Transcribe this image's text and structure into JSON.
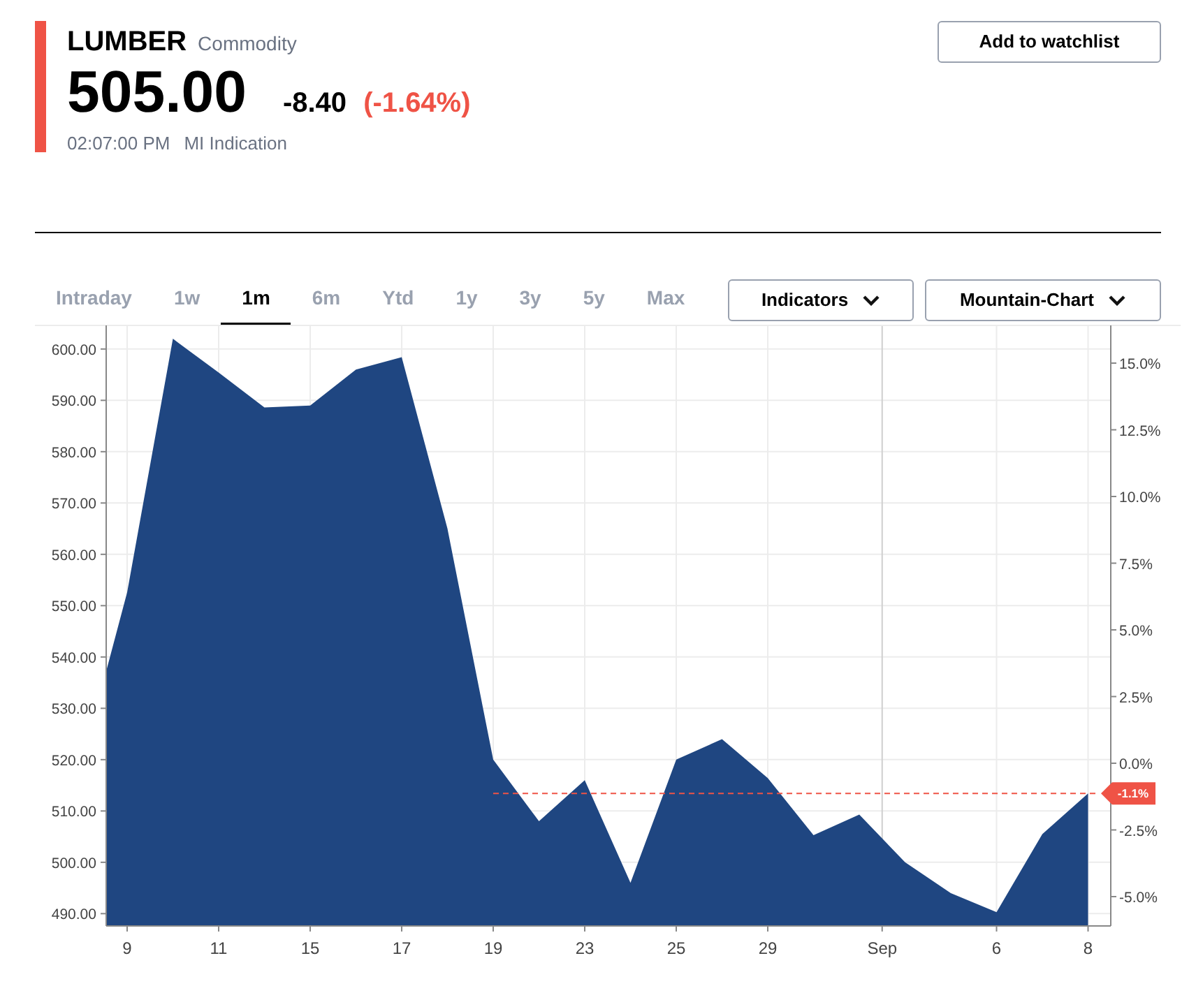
{
  "quote": {
    "symbol": "LUMBER",
    "type": "Commodity",
    "price": "505.00",
    "change": "-8.40",
    "change_percent": "(-1.64%)",
    "time": "02:07:00 PM",
    "source": "MI Indication"
  },
  "watchlist_button": "Add to watchlist",
  "range_tabs": [
    {
      "label": "Intraday",
      "selected": false
    },
    {
      "label": "1w",
      "selected": false
    },
    {
      "label": "1m",
      "selected": true
    },
    {
      "label": "6m",
      "selected": false
    },
    {
      "label": "Ytd",
      "selected": false
    },
    {
      "label": "1y",
      "selected": false
    },
    {
      "label": "3y",
      "selected": false
    },
    {
      "label": "5y",
      "selected": false
    },
    {
      "label": "Max",
      "selected": false
    }
  ],
  "dropdowns": [
    {
      "label": "Indicators"
    },
    {
      "label": "Mountain-Chart"
    }
  ],
  "chart": {
    "right_axis_labels": [
      "15.0%",
      "12.5%",
      "10.0%",
      "7.5%",
      "5.0%",
      "2.5%",
      "0.0%",
      "-2.5%",
      "-5.0%"
    ],
    "chart_data": {
      "type": "area",
      "categories": [
        null,
        "9",
        null,
        "11",
        null,
        "15",
        null,
        "17",
        null,
        "19",
        null,
        "23",
        null,
        "25",
        null,
        "29",
        null,
        null,
        null,
        null,
        "6",
        null,
        "8"
      ],
      "series": [
        {
          "color": "#1f4681",
          "values": [
            519.0,
            552.6,
            602,
            595.4,
            588.6,
            589,
            596,
            598.4,
            565,
            520,
            508,
            516,
            496,
            520,
            524,
            516.4,
            505.3,
            509.3,
            500,
            494,
            490.3,
            505.5,
            513.4
          ]
        }
      ],
      "ylim": [
        487.6,
        604.6
      ],
      "grid": true,
      "yticks": [
        {
          "value": 490,
          "label": "490.00"
        },
        {
          "value": 500,
          "label": "500.00"
        },
        {
          "value": 510,
          "label": "510.00"
        },
        {
          "value": 520,
          "label": "520.00"
        },
        {
          "value": 530,
          "label": "530.00"
        },
        {
          "value": 540,
          "label": "540.00"
        },
        {
          "value": 550,
          "label": "550.00"
        },
        {
          "value": 560,
          "label": "560.00"
        },
        {
          "value": 570,
          "label": "570.00"
        },
        {
          "value": 580,
          "label": "580.00"
        },
        {
          "value": 590,
          "label": "590.00"
        },
        {
          "value": 600,
          "label": "600.00"
        }
      ]
    },
    "month_label": "Sep",
    "last_change_tag": "-1.1%"
  }
}
